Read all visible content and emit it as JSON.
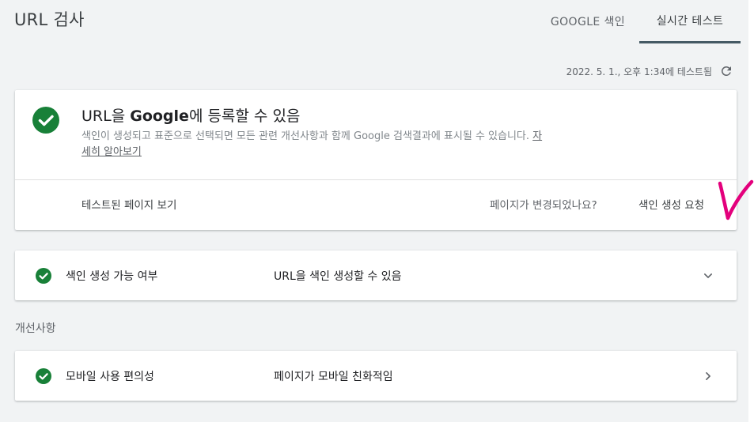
{
  "header": {
    "title": "URL 검사",
    "tabs": [
      {
        "label": "GOOGLE 색인",
        "active": false
      },
      {
        "label": "실시간 테스트",
        "active": true
      }
    ]
  },
  "test_status": {
    "timestamp": "2022. 5. 1., 오후 1:34에 테스트됨",
    "refresh_icon": "refresh-icon"
  },
  "main_card": {
    "status_icon": "check-circle-icon",
    "headline_prefix": "URL을",
    "headline_bold": "Google",
    "headline_suffix": "에 등록할 수 있음",
    "description": "색인이 생성되고 표준으로 선택되면 모든 관련 개선사항과 함께 Google 검색결과에 표시될 수 있습니다.",
    "learn_more": "자세히 알아보기",
    "view_tested_page": "테스트된 페이지 보기",
    "page_changed_question": "페이지가 변경되었나요?",
    "request_indexing": "색인 생성 요청"
  },
  "index_row": {
    "label": "색인 생성 가능 여부",
    "value": "URL을 색인 생성할 수 있음",
    "chevron": "chevron-down-icon"
  },
  "enhancements": {
    "section_title": "개선사항",
    "rows": [
      {
        "label": "모바일 사용 편의성",
        "value": "페이지가 모바일 친화적임",
        "chevron": "chevron-right-icon"
      }
    ]
  },
  "colors": {
    "success_green": "#188038",
    "tab_underline": "#455a64",
    "background": "#f1f3f4",
    "annotation_pink": "#e3007c"
  }
}
